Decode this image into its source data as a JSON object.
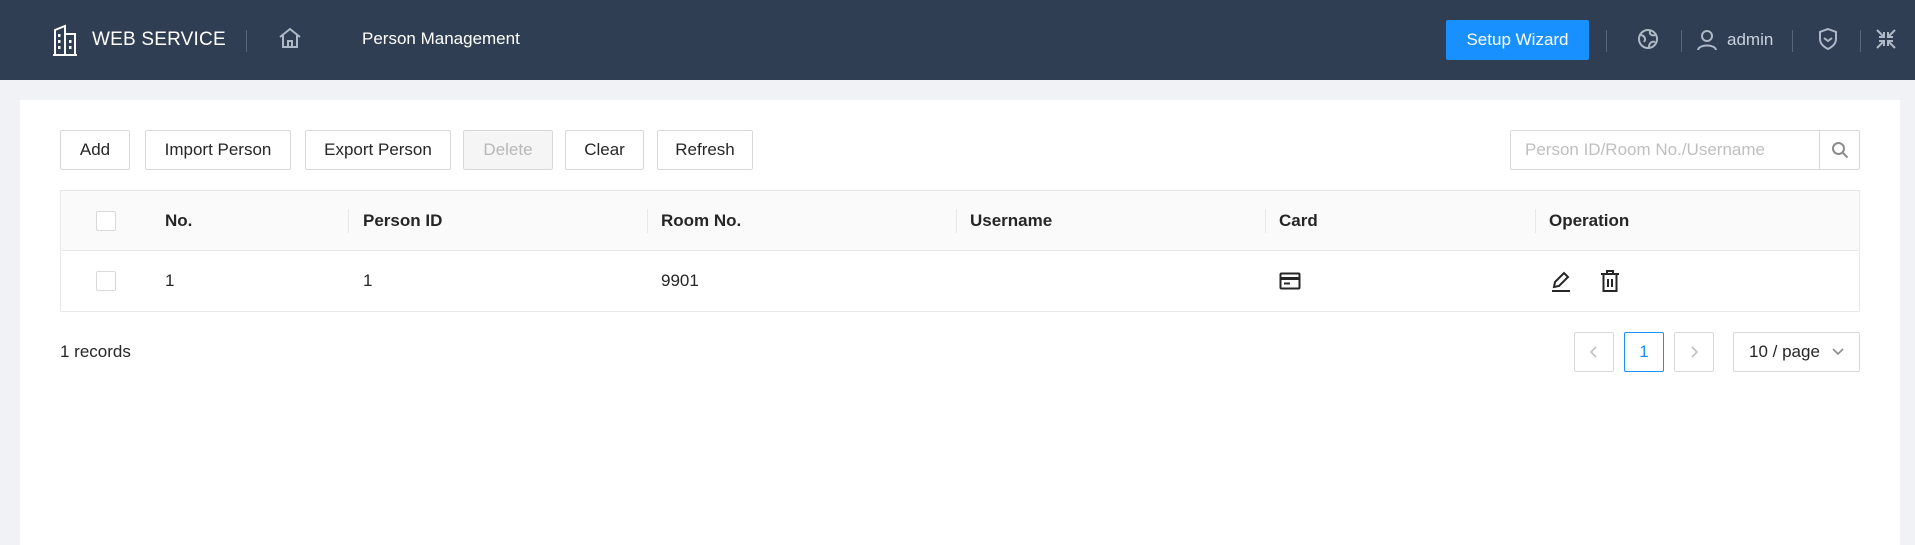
{
  "header": {
    "brand": "WEB SERVICE",
    "page_title": "Person Management",
    "setup_wizard": "Setup Wizard",
    "username": "admin"
  },
  "toolbar": {
    "add": "Add",
    "import": "Import Person",
    "export": "Export Person",
    "delete": "Delete",
    "clear": "Clear",
    "refresh": "Refresh"
  },
  "search": {
    "placeholder": "Person ID/Room No./Username"
  },
  "table": {
    "columns": [
      "No.",
      "Person ID",
      "Room No.",
      "Username",
      "Card",
      "Operation"
    ],
    "rows": [
      {
        "no": "1",
        "person_id": "1",
        "room_no": "9901",
        "username": "",
        "card_icon": "card-icon",
        "operation_icons": [
          "edit-icon",
          "delete-icon"
        ]
      }
    ]
  },
  "footer": {
    "records": "1 records",
    "current_page": "1",
    "page_size": "10 / page"
  },
  "colors": {
    "header_bg": "#2f3e52",
    "accent": "#1890ff"
  }
}
